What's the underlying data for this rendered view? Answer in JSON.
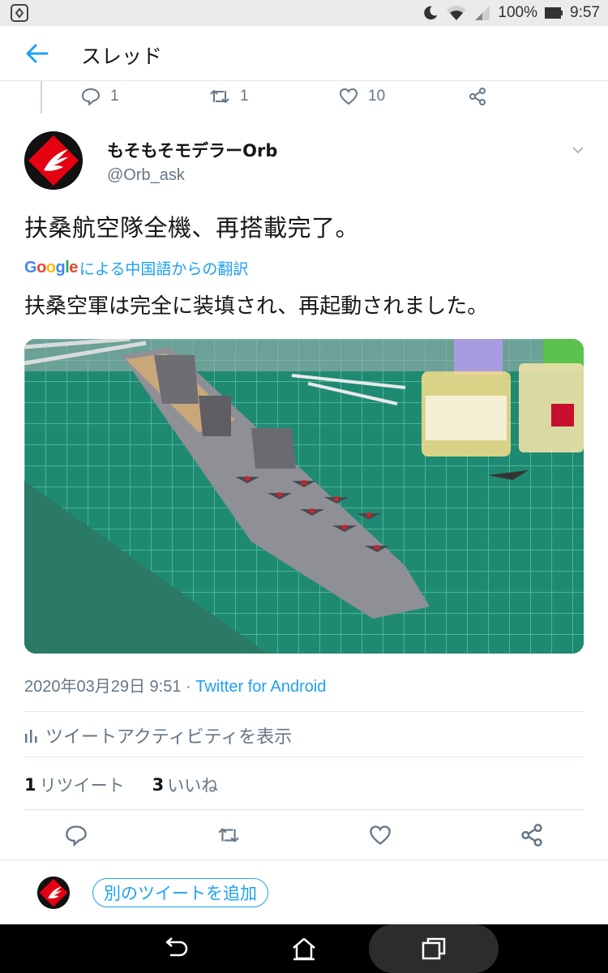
{
  "status_bar": {
    "battery": "100%",
    "time": "9:57",
    "icons": [
      "app-notification-icon",
      "do-not-disturb-moon-icon",
      "wifi-icon",
      "cell-signal-icon",
      "battery-icon"
    ]
  },
  "header": {
    "title": "スレッド",
    "back_icon": "arrow-left-icon"
  },
  "previous_tweet_actions": {
    "replies": "1",
    "retweets": "1",
    "likes": "10"
  },
  "tweet": {
    "author_name": "もそもそモデラーOrb",
    "handle": "@Orb_ask",
    "text": "扶桑航空隊全機、再搭載完了。",
    "translation_provider": "Google",
    "translation_label": "による中国語からの翻訳",
    "translated_text": "扶桑空軍は完全に装填され、再起動されました。",
    "date": "2020年03月29日 9:51",
    "separator": " · ",
    "source": "Twitter for Android",
    "activity_label": "ツイートアクティビティを表示",
    "retweet_count": "1",
    "retweet_label": "リツイート",
    "like_count": "3",
    "like_label": "いいね"
  },
  "reply_bar": {
    "add_tweet_label": "別のツイートを追加"
  },
  "colors": {
    "accent": "#1da1f2",
    "secondary_text": "#657786",
    "primary_text": "#14171a",
    "divider": "#e1e8ed",
    "avatar_red": "#e50012"
  },
  "nav_icons": [
    "back-nav-icon",
    "home-nav-icon",
    "recents-nav-icon"
  ]
}
